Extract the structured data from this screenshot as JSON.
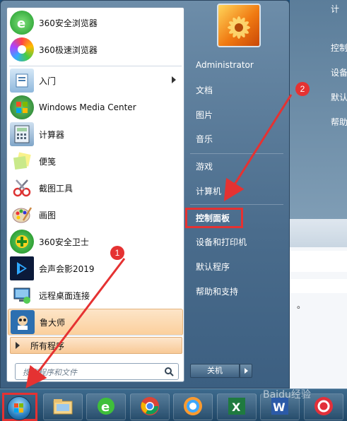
{
  "background": {
    "items": [
      "计",
      "控制",
      "设备",
      "默认",
      "帮助"
    ]
  },
  "left_pane": {
    "programs": [
      {
        "label": "360安全浏览器",
        "icon": "360-browser-icon"
      },
      {
        "label": "360极速浏览器",
        "icon": "360-extreme-browser-icon"
      },
      {
        "label": "入门",
        "icon": "getting-started-icon",
        "has_submenu": true
      },
      {
        "label": "Windows Media Center",
        "icon": "media-center-icon"
      },
      {
        "label": "计算器",
        "icon": "calculator-icon"
      },
      {
        "label": "便笺",
        "icon": "sticky-notes-icon"
      },
      {
        "label": "截图工具",
        "icon": "snipping-tool-icon"
      },
      {
        "label": "画图",
        "icon": "paint-icon"
      },
      {
        "label": "360安全卫士",
        "icon": "360-security-icon"
      },
      {
        "label": "会声会影2019",
        "icon": "video-editor-icon"
      },
      {
        "label": "远程桌面连接",
        "icon": "remote-desktop-icon"
      },
      {
        "label": "鲁大师",
        "icon": "ludashi-icon"
      }
    ],
    "all_programs": "所有程序",
    "search_placeholder": "搜索程序和文件"
  },
  "right_pane": {
    "user": "Administrator",
    "links": [
      "文档",
      "图片",
      "音乐",
      "游戏",
      "计算机",
      "控制面板",
      "设备和打印机",
      "默认程序",
      "帮助和支持"
    ],
    "shutdown": "关机"
  },
  "annotations": {
    "badge1": "1",
    "badge2": "2",
    "highlight_color": "#e53232"
  },
  "taskbar": {
    "items": [
      "start-orb",
      "explorer-icon",
      "ie-icon",
      "chrome-icon",
      "360-icon",
      "excel-icon",
      "word-icon",
      "app-icon"
    ]
  },
  "watermark": "Baidu经验"
}
